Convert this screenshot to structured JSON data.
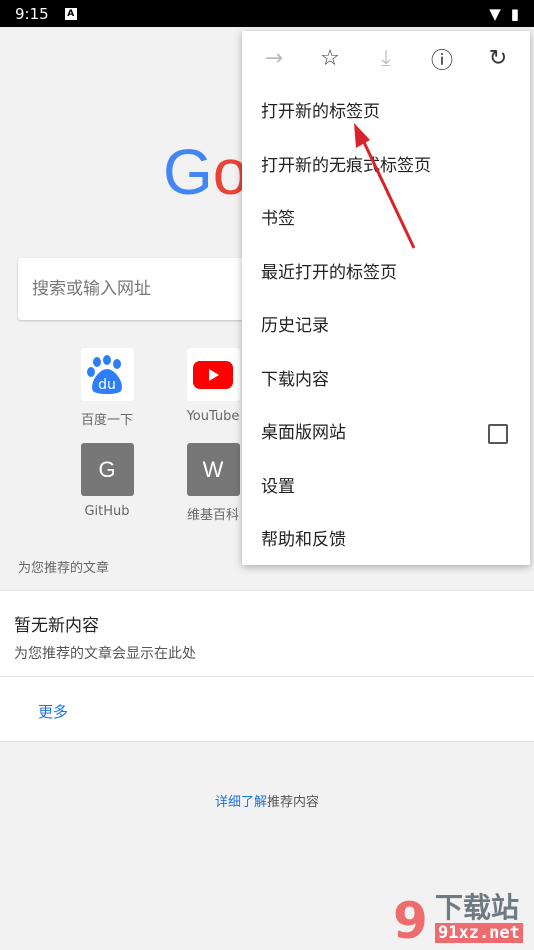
{
  "status": {
    "time": "9:15"
  },
  "logo": "Go",
  "search": {
    "placeholder": "搜索或输入网址"
  },
  "tiles": [
    {
      "label": "百度一下",
      "icon": "baidu-icon"
    },
    {
      "label": "YouTube",
      "icon": "youtube-icon"
    },
    {
      "label": "GitHub",
      "letter": "G"
    },
    {
      "label": "维基百科",
      "letter": "W"
    }
  ],
  "recommend": {
    "header": "为您推荐的文章",
    "title": "暂无新内容",
    "subtitle": "为您推荐的文章会显示在此处",
    "more": "更多"
  },
  "learn": {
    "link": "详细了解",
    "rest": "推荐内容"
  },
  "menu": {
    "toolbar": [
      "forward-icon",
      "star-icon",
      "download-icon",
      "info-icon",
      "refresh-icon"
    ],
    "items": [
      "打开新的标签页",
      "打开新的无痕式标签页",
      "书签",
      "最近打开的标签页",
      "历史记录",
      "下载内容",
      "桌面版网站",
      "设置",
      "帮助和反馈"
    ]
  },
  "watermark": {
    "text": "下载站",
    "url": "91xz.net"
  },
  "colors": {
    "accent": "#1a73e8",
    "arrow": "#d9232a"
  }
}
